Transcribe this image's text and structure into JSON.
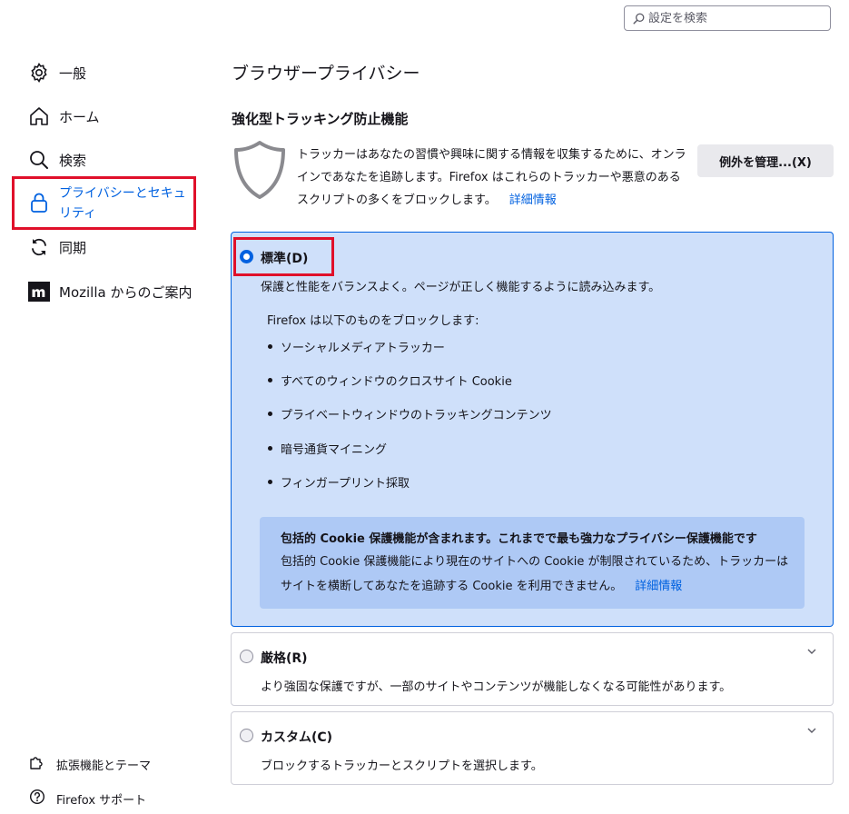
{
  "search": {
    "placeholder": "設定を検索"
  },
  "sidebar": {
    "items": [
      {
        "label": "一般",
        "icon": "gear-icon"
      },
      {
        "label": "ホーム",
        "icon": "home-icon"
      },
      {
        "label": "検索",
        "icon": "search-icon"
      },
      {
        "label": "プライバシーとセキュリティ",
        "icon": "lock-icon",
        "selected": true
      },
      {
        "label": "同期",
        "icon": "sync-icon"
      },
      {
        "label": "Mozilla からのご案内",
        "icon": "mozilla-logo-icon"
      }
    ],
    "footer": [
      {
        "label": "拡張機能とテーマ",
        "icon": "puzzle-icon"
      },
      {
        "label": "Firefox サポート",
        "icon": "help-icon"
      }
    ]
  },
  "main": {
    "title": "ブラウザープライバシー",
    "section_heading": "強化型トラッキング防止機能",
    "intro_text": "トラッカーはあなたの習慣や興味に関する情報を収集するために、オンラインであなたを追跡します。Firefox はこれらのトラッカーや悪意のあるスクリプトの多くをブロックします。",
    "intro_link": "詳細情報",
    "manage_exceptions_button": "例外を管理...(X)",
    "options": {
      "standard": {
        "title": "標準(D)",
        "desc": "保護と性能をバランスよく。ページが正しく機能するように読み込みます。",
        "blocks_heading": "Firefox は以下のものをブロックします:",
        "blocks": [
          "ソーシャルメディアトラッカー",
          "すべてのウィンドウのクロスサイト Cookie",
          "プライベートウィンドウのトラッキングコンテンツ",
          "暗号通貨マイニング",
          "フィンガープリント採取"
        ],
        "cookie_title": "包括的 Cookie 保護機能が含まれます。これまでで最も強力なプライバシー保護機能です",
        "cookie_text": "包括的 Cookie 保護機能により現在のサイトへの Cookie が制限されているため、トラッカーはサイトを横断してあなたを追跡する Cookie を利用できません。",
        "cookie_link": "詳細情報"
      },
      "strict": {
        "title": "厳格(R)",
        "desc": "より強固な保護ですが、一部のサイトやコンテンツが機能しなくなる可能性があります。"
      },
      "custom": {
        "title": "カスタム(C)",
        "desc": "ブロックするトラッカーとスクリプトを選択します。"
      }
    }
  },
  "colors": {
    "accent": "#0061e0",
    "highlight": "#e0102a",
    "selected_card_bg": "#cfe0fa",
    "cookie_box_bg": "#aec9f5"
  }
}
